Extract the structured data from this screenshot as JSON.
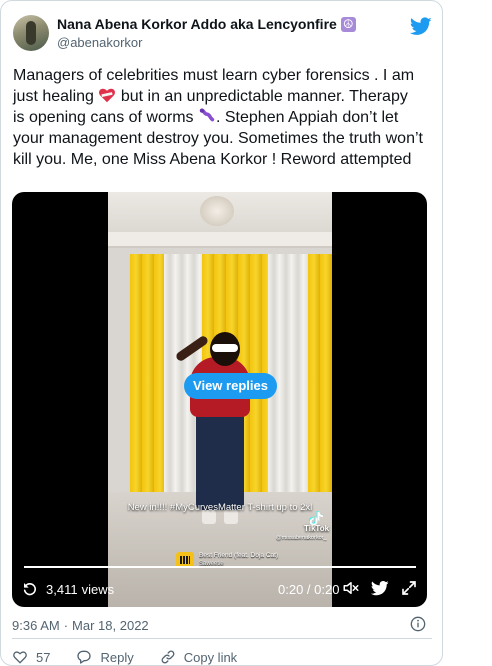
{
  "author": {
    "display_name": "Nana Abena Korkor Addo aka Lencyonfire",
    "name_emoji": "☮",
    "handle": "@abenakorkor"
  },
  "tweet": {
    "segments": [
      "Managers of celebrities must learn cyber forensics . I am just healing ",
      " but in an unpredictable manner. Therapy is opening cans of worms ",
      ". Stephen Appiah don’t let your management destroy you. Sometimes the truth won’t kill you. Me, one Miss Abena Korkor ! Reword attempted"
    ],
    "emoji_icons": [
      "mending-heart-icon",
      "worm-icon"
    ]
  },
  "video": {
    "overlay_caption": "New in!!!! #MyCurvesMatter T-shirt up to 2xl",
    "tiktok_label": "TikTok",
    "tiktok_handle": "@missabenakorkor_",
    "sound_title": "Best Friend (feat. Doja Cat)",
    "sound_artist": "Saweetie",
    "view_replies_label": "View replies",
    "views_count": "3,411",
    "views_label": "views",
    "time_display": "0:20 / 0:20",
    "progress_fraction": 1.0
  },
  "meta": {
    "time": "9:36 AM",
    "separator": "·",
    "date": "Mar 18, 2022"
  },
  "actions": {
    "likes_count": "57",
    "reply_label": "Reply",
    "copy_link_label": "Copy link"
  },
  "colors": {
    "twitter_blue": "#1d9bf0",
    "text_primary": "#0f1419",
    "text_secondary": "#536471",
    "like_heart": "#536471"
  }
}
